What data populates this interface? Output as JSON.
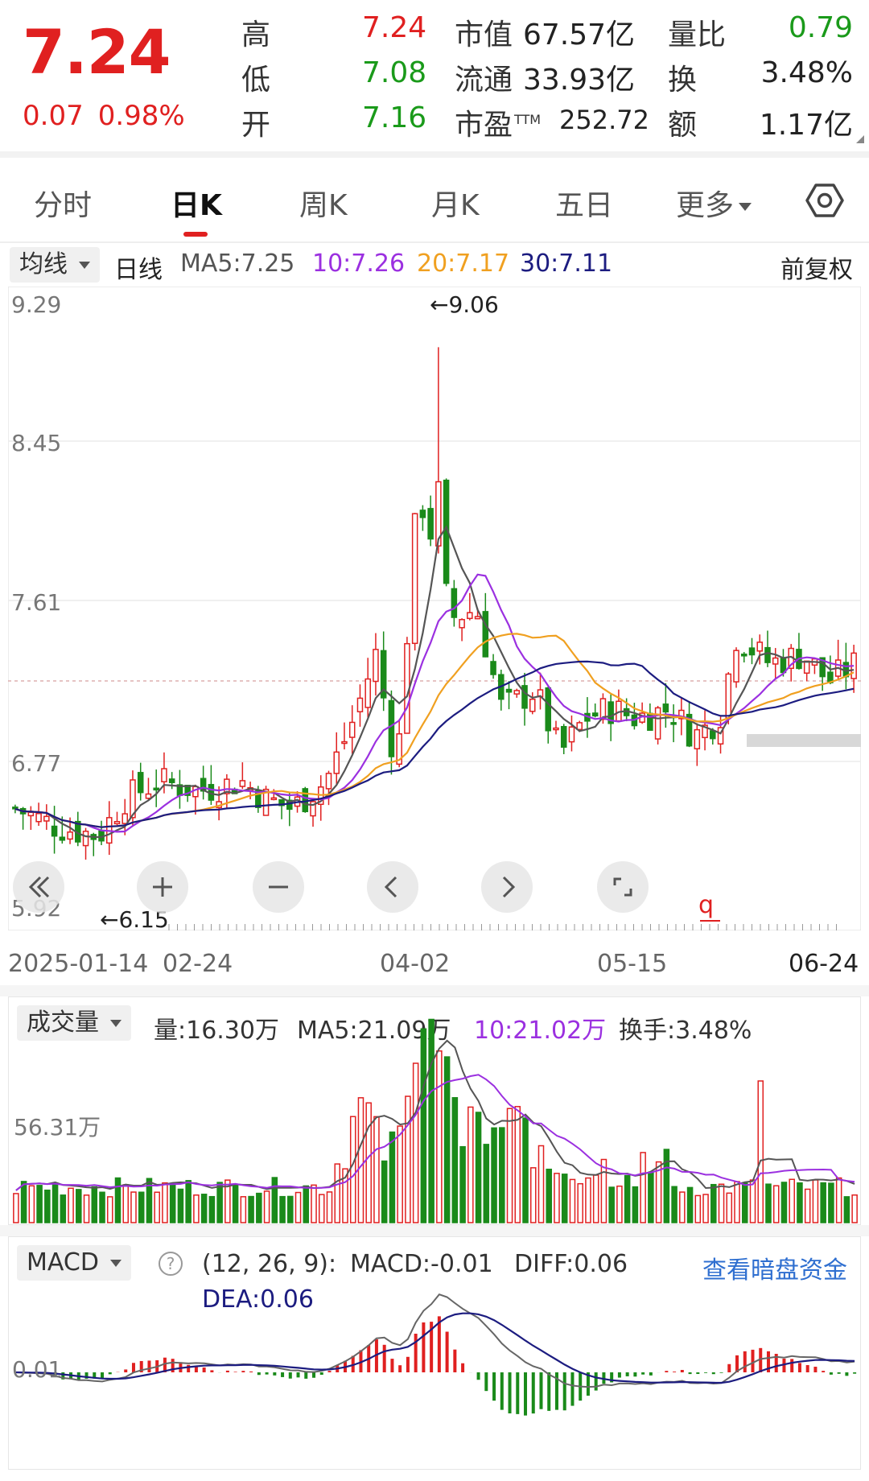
{
  "quote": {
    "price": "7.24",
    "change": "0.07",
    "change_pct": "0.98%",
    "rows": [
      {
        "l1": "高",
        "v1": "7.24",
        "c1": "red",
        "l2": "市值",
        "v2": "67.57亿",
        "l3": "量比",
        "v3": "0.79",
        "c3": "green"
      },
      {
        "l1": "低",
        "v1": "7.08",
        "c1": "green",
        "l2": "流通",
        "v2": "33.93亿",
        "l3": "换",
        "v3": "3.48%",
        "c3": "dark"
      },
      {
        "l1": "开",
        "v1": "7.16",
        "c1": "green",
        "l2": "市盈",
        "l2sup": "TTM",
        "v2": "252.72",
        "l3": "额",
        "v3": "1.17亿",
        "c3": "dark"
      }
    ]
  },
  "tabs": {
    "items": [
      "分时",
      "日K",
      "周K",
      "月K",
      "五日",
      "更多"
    ],
    "active": "日K",
    "settings_icon": "hexagon-settings-icon"
  },
  "ma_bar": {
    "selector": "均线",
    "period": "日线",
    "ma5": "MA5:7.25",
    "ma10": "10:7.26",
    "ma20": "20:7.17",
    "ma30": "30:7.11",
    "adjust": "前复权",
    "colors": {
      "ma5": "#555555",
      "ma10": "#9b30e0",
      "ma20": "#f0a020",
      "ma30": "#1c1c80"
    }
  },
  "kchart": {
    "y_ticks": [
      "9.29",
      "8.45",
      "7.61",
      "6.77",
      "5.92"
    ],
    "x_ticks": [
      "2025-01-14",
      "02-24",
      "04-02",
      "05-15",
      "06-24"
    ],
    "high_label": "←9.06",
    "low_label": "←6.15",
    "up_color": "#e02020",
    "down_color": "#1a8a1a"
  },
  "controls": {
    "rewind_icon": "double-left-icon",
    "zoom_in_icon": "plus-icon",
    "zoom_out_icon": "minus-icon",
    "prev_icon": "chevron-left-icon",
    "next_icon": "chevron-right-icon",
    "fullscreen_icon": "expand-icon"
  },
  "volume": {
    "selector": "成交量",
    "vol": "量:16.30万",
    "ma5": "MA5:21.09万",
    "ma10": "10:21.02万",
    "turnover": "换手:3.48%",
    "y_tick": "56.31万"
  },
  "macd": {
    "selector": "MACD",
    "params": "(12, 26, 9):",
    "macd_val": "MACD:-0.01",
    "diff": "DIFF:0.06",
    "dea": "DEA:0.06",
    "link": "查看暗盘资金",
    "y_tick": "0.01"
  }
}
